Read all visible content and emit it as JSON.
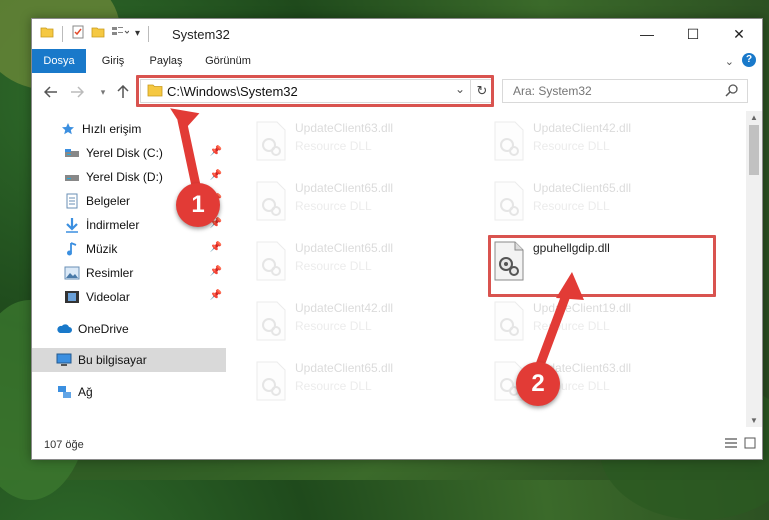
{
  "window": {
    "title": "System32",
    "minimize": "—",
    "maximize": "☐",
    "close": "✕"
  },
  "ribbon": {
    "tabs": [
      "Dosya",
      "Giriş",
      "Paylaş",
      "Görünüm"
    ],
    "help": "?"
  },
  "address": {
    "path": "C:\\Windows\\System32",
    "dropdown": "⌄",
    "refresh": "↻"
  },
  "search": {
    "placeholder": "Ara: System32"
  },
  "sidebar": {
    "items": [
      {
        "label": "Hızlı erişim",
        "icon": "star-icon"
      },
      {
        "label": "Yerel Disk (C:)",
        "icon": "drive-icon",
        "pinned": true
      },
      {
        "label": "Yerel Disk (D:)",
        "icon": "drive-icon",
        "pinned": true
      },
      {
        "label": "Belgeler",
        "icon": "documents-icon",
        "pinned": true
      },
      {
        "label": "İndirmeler",
        "icon": "download-icon",
        "pinned": true
      },
      {
        "label": "Müzik",
        "icon": "music-icon",
        "pinned": true
      },
      {
        "label": "Resimler",
        "icon": "pictures-icon",
        "pinned": true
      },
      {
        "label": "Videolar",
        "icon": "videos-icon",
        "pinned": true
      },
      {
        "label": "OneDrive",
        "icon": "cloud-icon"
      },
      {
        "label": "Bu bilgisayar",
        "icon": "computer-icon",
        "selected": true
      },
      {
        "label": "Ağ",
        "icon": "network-icon"
      }
    ]
  },
  "files": {
    "left": [
      {
        "name": "UpdateClient63.dll",
        "desc": "Resource DLL"
      },
      {
        "name": "UpdateClient65.dll",
        "desc": "Resource DLL"
      },
      {
        "name": "UpdateClient65.dll",
        "desc": "Resource DLL"
      },
      {
        "name": "UpdateClient42.dll",
        "desc": "Resource DLL"
      },
      {
        "name": "UpdateClient65.dll",
        "desc": "Resource DLL"
      }
    ],
    "right": [
      {
        "name": "UpdateClient42.dll",
        "desc": "Resource DLL"
      },
      {
        "name": "UpdateClient65.dll",
        "desc": "Resource DLL"
      },
      {
        "name": "gpuhellgdip.dll",
        "desc": "",
        "highlight": true
      },
      {
        "name": "UpdateClient19.dll",
        "desc": "Resource DLL"
      },
      {
        "name": "UpdateClient63.dll",
        "desc": "Resource DLL"
      }
    ]
  },
  "status": {
    "count": "107 öğe"
  },
  "callouts": [
    "1",
    "2"
  ],
  "colors": {
    "accent": "#1979ca",
    "highlight": "#d9534f",
    "callout": "#e23b36"
  }
}
